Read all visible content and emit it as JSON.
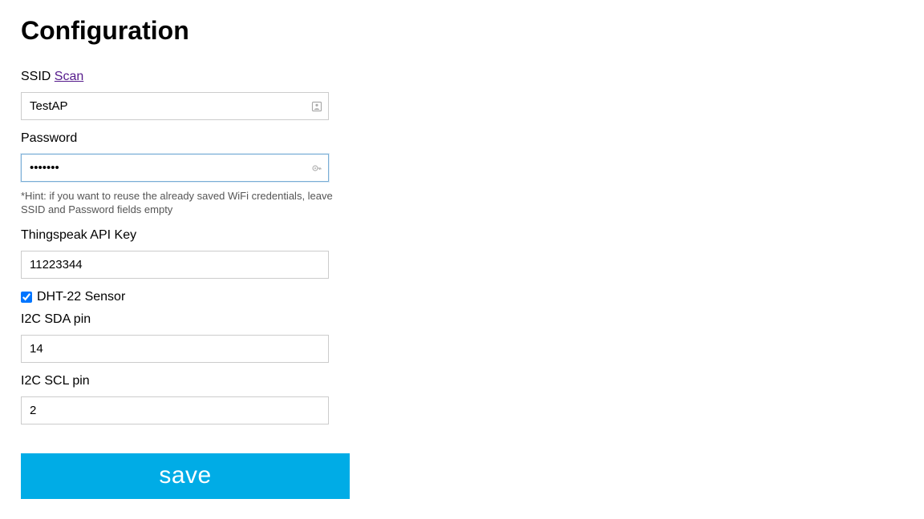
{
  "title": "Configuration",
  "ssid": {
    "label": "SSID",
    "scan_link": "Scan",
    "value": "TestAP"
  },
  "password": {
    "label": "Password",
    "value": "•••••••"
  },
  "hint": "*Hint: if you want to reuse the already saved WiFi credentials, leave SSID and Password fields empty",
  "apikey": {
    "label": "Thingspeak API Key",
    "value": "11223344"
  },
  "dht22": {
    "label": "DHT-22 Sensor",
    "checked": true
  },
  "sda": {
    "label": "I2C SDA pin",
    "value": "14"
  },
  "scl": {
    "label": "I2C SCL pin",
    "value": "2"
  },
  "save_button": "save"
}
